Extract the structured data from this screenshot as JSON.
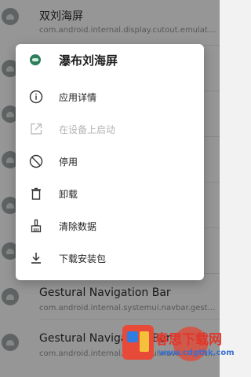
{
  "background_list": [
    {
      "title": "双刘海屏",
      "package": "com.android.internal.display.cutout.emulation..."
    },
    {
      "title": "",
      "package": ""
    },
    {
      "title": "",
      "package": ""
    },
    {
      "title": "",
      "package": ""
    },
    {
      "title": "",
      "package": ""
    },
    {
      "title": "",
      "package": ""
    },
    {
      "title": "Gestural Navigation Bar",
      "package": "com.android.internal.systemui.navbar.gestor..."
    },
    {
      "title": "Gestural Navigation Bar",
      "package": "com.android.internal.systemui.navbar.gestur..."
    }
  ],
  "dialog": {
    "app_name": "瀑布刘海屏",
    "items": [
      {
        "label": "应用详情",
        "icon": "info-icon",
        "enabled": true
      },
      {
        "label": "在设备上启动",
        "icon": "launch-icon",
        "enabled": false
      },
      {
        "label": "停用",
        "icon": "block-icon",
        "enabled": true
      },
      {
        "label": "卸载",
        "icon": "trash-icon",
        "enabled": true
      },
      {
        "label": "清除数据",
        "icon": "broom-icon",
        "enabled": true
      },
      {
        "label": "下载安装包",
        "icon": "download-icon",
        "enabled": true
      }
    ]
  },
  "watermark": {
    "title": "春思下载网",
    "url": "www.cdgthk.com"
  },
  "colors": {
    "accent": "#2e7d5b",
    "scrim": "rgba(0,0,0,0.38)",
    "fab": "#d9503f"
  }
}
